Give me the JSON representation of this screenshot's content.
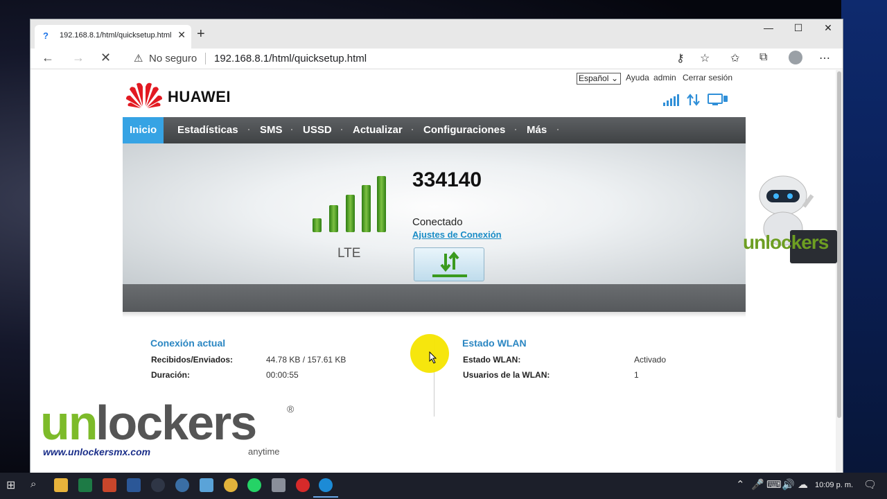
{
  "browser": {
    "tab_title": "192.168.8.1/html/quicksetup.html",
    "tab_favicon": "?",
    "security_label": "No seguro",
    "url": "192.168.8.1/html/quicksetup.html",
    "window_controls": [
      "—",
      "☐",
      "✕"
    ]
  },
  "header": {
    "language": "Español",
    "help": "Ayuda",
    "user": "admin",
    "logout": "Cerrar sesión",
    "brand": "HUAWEI"
  },
  "menu": {
    "items": [
      {
        "label": "Inicio",
        "active": true
      },
      {
        "label": "Estadísticas",
        "active": false
      },
      {
        "label": "SMS",
        "active": false
      },
      {
        "label": "USSD",
        "active": false
      },
      {
        "label": "Actualizar",
        "active": false
      },
      {
        "label": "Configuraciones",
        "active": false
      },
      {
        "label": "Más",
        "active": false
      }
    ]
  },
  "status": {
    "network_type": "LTE",
    "signal_bars": 5,
    "operator": "334140",
    "connection_state": "Conectado",
    "connection_settings_link": "Ajustes de Conexión"
  },
  "current_connection": {
    "title": "Conexión actual",
    "rows": [
      {
        "label": "Recibidos/Enviados:",
        "value": "44.78 KB /  157.61 KB"
      },
      {
        "label": "Duración:",
        "value": "00:00:55"
      }
    ]
  },
  "wlan": {
    "title": "Estado WLAN",
    "rows": [
      {
        "label": "Estado WLAN:",
        "value": "Activado"
      },
      {
        "label": "Usuarios de la WLAN:",
        "value": "1"
      }
    ]
  },
  "watermark": {
    "brand_prefix": "un",
    "brand_rest": "lockers",
    "reg": "®",
    "url": "www.unlockersmx.com",
    "tagline": "anytime",
    "robot_brand": "unlockers"
  },
  "taskbar": {
    "clock": "10:09 p. m."
  },
  "colors": {
    "accent": "#36a3e4",
    "link": "#1a8cc6",
    "signal_green": "#4f9a1f",
    "huawei_red": "#e21a22",
    "cursor_highlight": "#f6e500"
  }
}
